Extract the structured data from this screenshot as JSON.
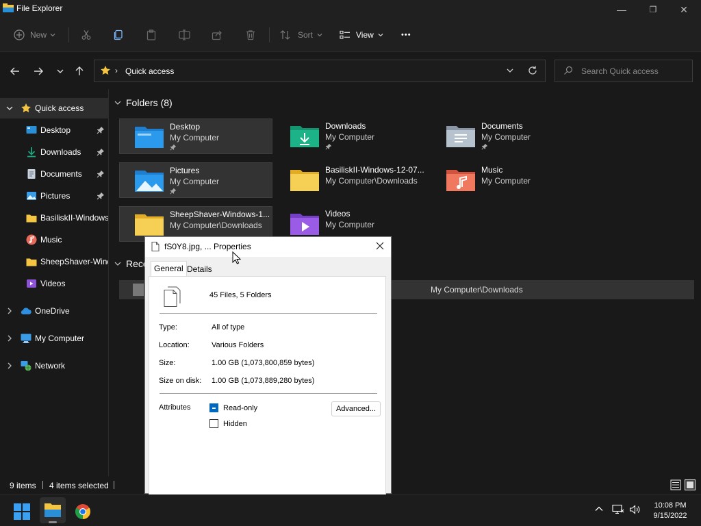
{
  "window": {
    "title": "File Explorer",
    "minimize_glyph": "—",
    "maximize_glyph": "❐",
    "close_glyph": "✕"
  },
  "toolbar": {
    "new_label": "New",
    "sort_label": "Sort",
    "view_label": "View",
    "more_glyph": "•••"
  },
  "address": {
    "location": "Quick access",
    "search_placeholder": "Search Quick access"
  },
  "sidebar": {
    "items": [
      {
        "label": "Quick access",
        "pinned": false
      },
      {
        "label": "Desktop",
        "pinned": true
      },
      {
        "label": "Downloads",
        "pinned": true
      },
      {
        "label": "Documents",
        "pinned": true
      },
      {
        "label": "Pictures",
        "pinned": true
      },
      {
        "label": "BasiliskII-Windows",
        "pinned": false
      },
      {
        "label": "Music",
        "pinned": false
      },
      {
        "label": "SheepShaver-Windows",
        "pinned": false
      },
      {
        "label": "Videos",
        "pinned": false
      },
      {
        "label": "OneDrive",
        "pinned": false
      },
      {
        "label": "My Computer",
        "pinned": false
      },
      {
        "label": "Network",
        "pinned": false
      }
    ]
  },
  "main": {
    "folders_header": "Folders (8)",
    "recent_header": "Recent",
    "folders": [
      {
        "name": "Desktop",
        "path": "My Computer",
        "pinned": true,
        "selected": true
      },
      {
        "name": "Downloads",
        "path": "My Computer",
        "pinned": true,
        "selected": false
      },
      {
        "name": "Documents",
        "path": "My Computer",
        "pinned": true,
        "selected": false
      },
      {
        "name": "Pictures",
        "path": "My Computer",
        "pinned": true,
        "selected": true
      },
      {
        "name": "BasiliskII-Windows-12-07...",
        "path": "My Computer\\Downloads",
        "pinned": false,
        "selected": false
      },
      {
        "name": "Music",
        "path": "My Computer",
        "pinned": false,
        "selected": false
      },
      {
        "name": "SheepShaver-Windows-1...",
        "path": "My Computer\\Downloads",
        "pinned": false,
        "selected": true
      },
      {
        "name": "Videos",
        "path": "My Computer",
        "pinned": false,
        "selected": false
      }
    ],
    "recent_row_path": "My Computer\\Downloads"
  },
  "status": {
    "items_count": "9 items",
    "selected_count": "4 items selected"
  },
  "dialog": {
    "title": "fS0Y8.jpg, ... Properties",
    "tabs": [
      "General",
      "Details"
    ],
    "summary": "45 Files, 5 Folders",
    "properties": [
      {
        "label": "Type:",
        "value": "All of type"
      },
      {
        "label": "Location:",
        "value": "Various Folders"
      },
      {
        "label": "Size:",
        "value": "1.00 GB (1,073,800,859 bytes)"
      },
      {
        "label": "Size on disk:",
        "value": "1.00 GB (1,073,889,280 bytes)"
      }
    ],
    "attributes_label": "Attributes",
    "readonly_label": "Read-only",
    "hidden_label": "Hidden",
    "advanced_label": "Advanced..."
  },
  "taskbar": {
    "time": "10:08 PM",
    "date": "9/15/2022"
  },
  "colors": {
    "folder_yellow": "#f4c542",
    "folder_blue": "#2b8fd8",
    "folder_teal": "#1aa87f",
    "accent": "#0067c0"
  }
}
